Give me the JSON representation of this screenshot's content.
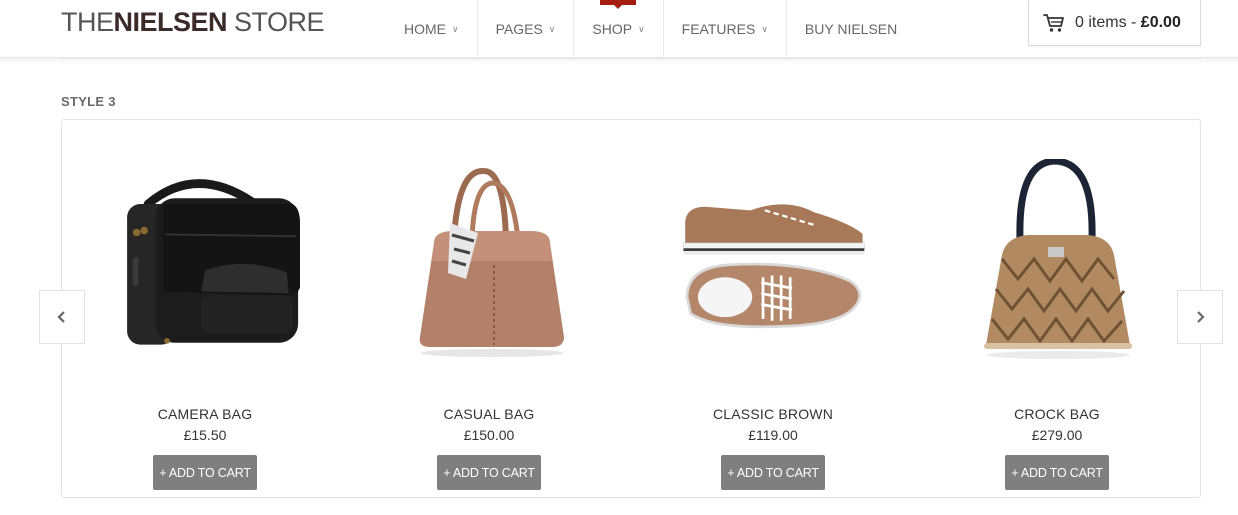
{
  "header": {
    "logo": {
      "word1": "THE",
      "word2": "NIELSEN",
      "word3": "STORE"
    },
    "nav": [
      {
        "label": "HOME",
        "has_dropdown": true
      },
      {
        "label": "PAGES",
        "has_dropdown": true
      },
      {
        "label": "SHOP",
        "has_dropdown": true,
        "active": true
      },
      {
        "label": "FEATURES",
        "has_dropdown": true
      },
      {
        "label": "BUY NIELSEN",
        "has_dropdown": false
      }
    ],
    "cart": {
      "icon": "cart-icon",
      "items_text": "0 items -",
      "total": "£0.00"
    }
  },
  "section": {
    "title": "STYLE 3",
    "prev_icon": "chevron-left-icon",
    "next_icon": "chevron-right-icon",
    "products": [
      {
        "name": "CAMERA BAG",
        "price": "£15.50",
        "button": "+ ADD TO CART"
      },
      {
        "name": "CASUAL BAG",
        "price": "£150.00",
        "button": "+ ADD TO CART"
      },
      {
        "name": "CLASSIC BROWN",
        "price": "£119.00",
        "button": "+ ADD TO CART"
      },
      {
        "name": "CROCK BAG",
        "price": "£279.00",
        "button": "+ ADD TO CART"
      }
    ]
  },
  "colors": {
    "accent": "#a51d10",
    "button_bg": "#7f7f7f",
    "border": "#e3e3e3"
  }
}
